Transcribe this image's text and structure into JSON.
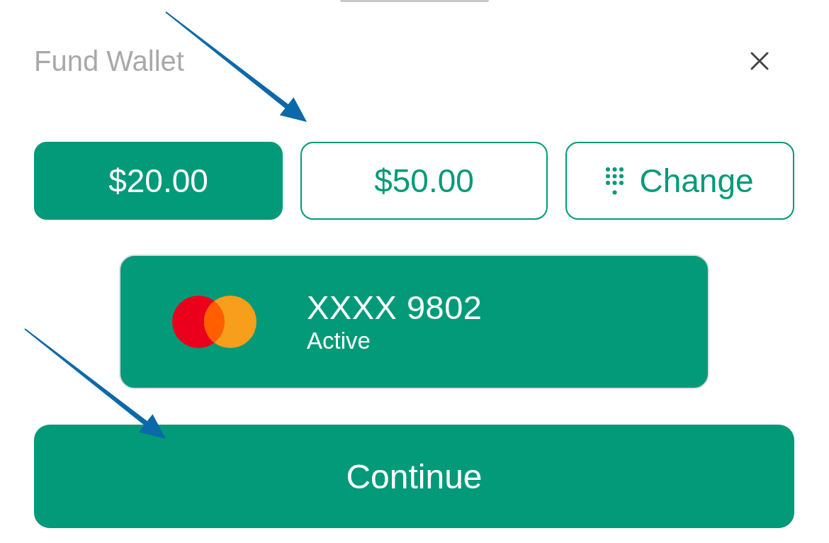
{
  "sheet": {
    "title": "Fund Wallet"
  },
  "amounts": [
    {
      "kind": "amount",
      "label": "$20.00",
      "selected": true
    },
    {
      "kind": "amount",
      "label": "$50.00",
      "selected": false
    },
    {
      "kind": "custom",
      "label": "Change",
      "selected": false
    }
  ],
  "card": {
    "number": "XXXX 9802",
    "status": "Active"
  },
  "primary_button": {
    "label": "Continue"
  },
  "annotations": [
    {
      "kind": "arrow"
    },
    {
      "kind": "arrow"
    }
  ]
}
